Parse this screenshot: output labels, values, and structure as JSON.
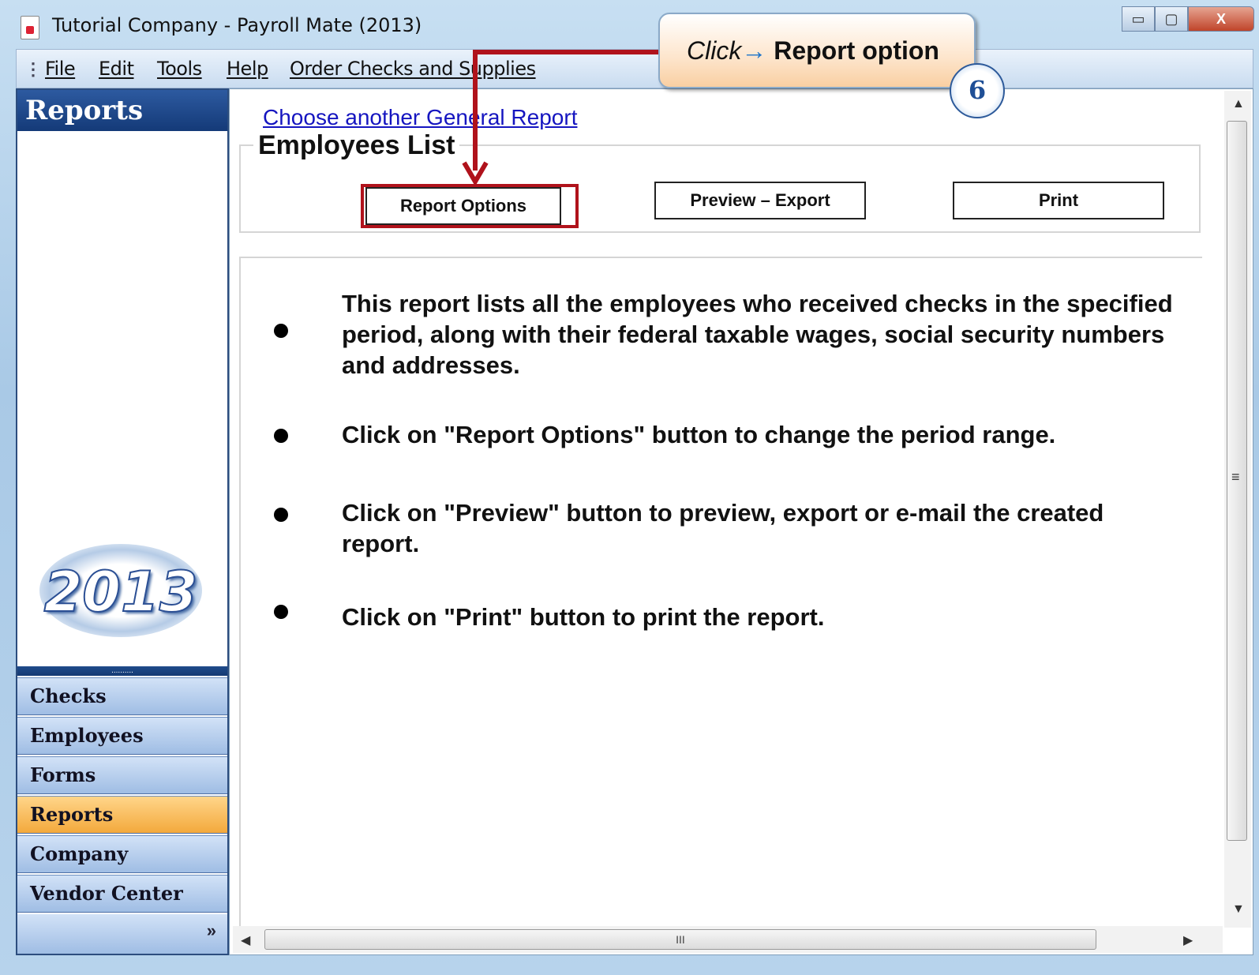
{
  "window": {
    "title": "Tutorial Company - Payroll Mate (2013)",
    "minimize_glyph": "▭",
    "maximize_glyph": "▢",
    "close_glyph": "X"
  },
  "menu": {
    "grip": "⋮",
    "items": [
      "File",
      "Edit",
      "Tools",
      "Help",
      "Order Checks and Supplies"
    ]
  },
  "sidebar": {
    "header": "Reports",
    "logo_year": "2013",
    "splitter_grip": "..........",
    "nav": [
      "Checks",
      "Employees",
      "Forms",
      "Reports",
      "Company",
      "Vendor Center"
    ],
    "active": "Reports",
    "more_glyph": "»"
  },
  "report": {
    "choose_link": "Choose another General Report",
    "group_title": "Employees List",
    "buttons": {
      "options": "Report Options",
      "preview": "Preview – Export",
      "print": "Print"
    },
    "descriptions": [
      "This report lists all the employees who received checks in the specified period, along with their federal taxable wages, social security numbers and addresses.",
      "Click on \"Report Options\" button to change the period range.",
      "Click on \"Preview\" button to preview, export or e-mail the created report.",
      "Click on \"Print\" button to print the report."
    ]
  },
  "scrollbar": {
    "up": "▲",
    "down": "▼",
    "left": "◀",
    "right": "▶",
    "vgrip": "≡",
    "hgrip": "III"
  },
  "tutorial": {
    "callout_click": "Click",
    "callout_arrow": "→",
    "callout_target": "Report option",
    "step_number": "6"
  },
  "colors": {
    "accent_navy": "#143a78",
    "active_nav": "#f3a93c",
    "highlight_red": "#b0121b",
    "link_blue": "#1515c0"
  }
}
